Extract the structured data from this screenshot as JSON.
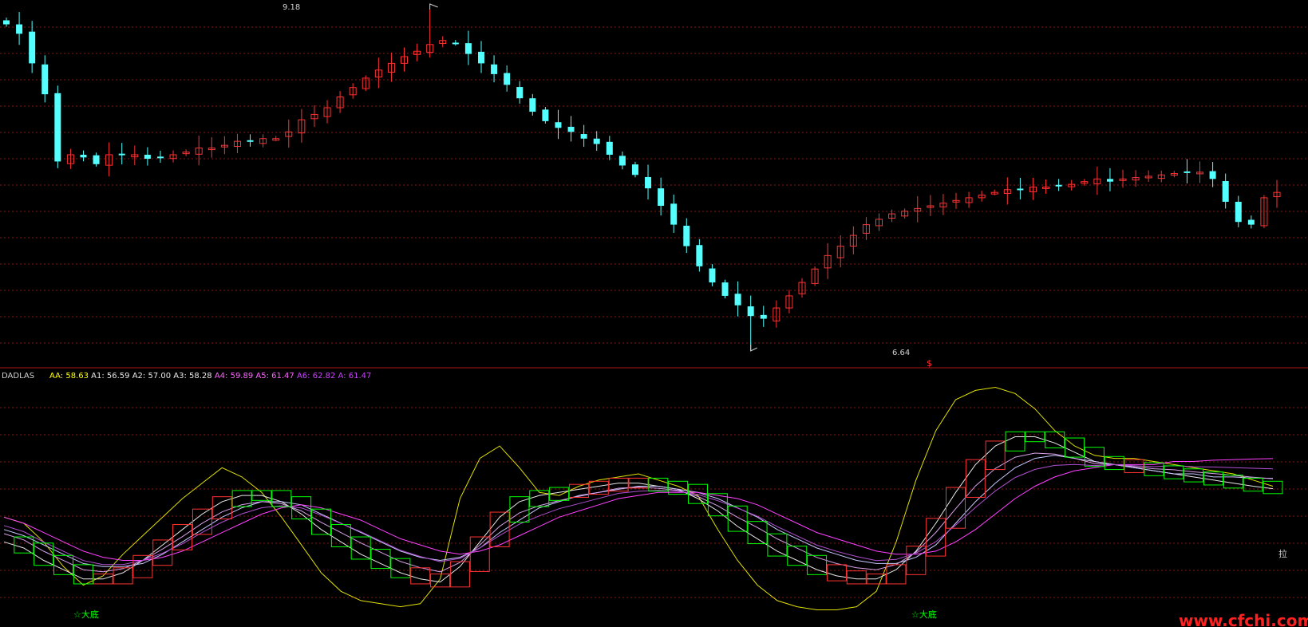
{
  "colors": {
    "background": "#000000",
    "grid": "#8a1414",
    "divider": "#b01818",
    "up": "#ff3232",
    "down": "#54ffff",
    "yellow": "#e0e000",
    "white": "#e8e8e8",
    "violet": "#ff40ff",
    "green": "#00ff00",
    "watermark": "#ff2020"
  },
  "price_panel": {
    "high_label": "9.18",
    "low_label": "6.64",
    "marker": "$"
  },
  "indicator_panel": {
    "name": "DADLAS",
    "values": [
      {
        "key": "AA",
        "value": "58.63",
        "color": "#ffff00"
      },
      {
        "key": "A1",
        "value": "56.59",
        "color": "#e8e8e8"
      },
      {
        "key": "A2",
        "value": "57.00",
        "color": "#e8e8e8"
      },
      {
        "key": "A3",
        "value": "58.28",
        "color": "#e8e8e8"
      },
      {
        "key": "A4",
        "value": "59.89",
        "color": "#ff66ff"
      },
      {
        "key": "A5",
        "value": "61.47",
        "color": "#ff66ff"
      },
      {
        "key": "A6",
        "value": "62.82",
        "color": "#cc44ff"
      },
      {
        "key": "A",
        "value": "61.47",
        "color": "#cc44ff"
      }
    ],
    "signal_labels": [
      "☆大底",
      "☆大底"
    ],
    "side_label": "拉"
  },
  "watermark": "www.cfchi.com",
  "chart_data": [
    {
      "type": "candlestick",
      "annotations": [
        "9.18",
        "6.64"
      ],
      "closes": [
        9.07,
        9.0,
        8.78,
        8.55,
        8.05,
        8.1,
        8.08,
        8.03,
        8.1,
        8.1,
        8.1,
        8.07,
        8.08,
        8.1,
        8.12,
        8.15,
        8.15,
        8.17,
        8.2,
        8.2,
        8.22,
        8.22,
        8.27,
        8.36,
        8.4,
        8.45,
        8.53,
        8.6,
        8.67,
        8.73,
        8.78,
        8.83,
        8.87,
        8.92,
        8.95,
        8.93,
        8.85,
        8.78,
        8.7,
        8.62,
        8.52,
        8.42,
        8.35,
        8.3,
        8.27,
        8.22,
        8.18,
        8.1,
        8.02,
        7.95,
        7.85,
        7.72,
        7.58,
        7.42,
        7.27,
        7.15,
        7.05,
        6.98,
        6.9,
        6.88,
        6.96,
        7.05,
        7.15,
        7.25,
        7.35,
        7.42,
        7.5,
        7.58,
        7.62,
        7.66,
        7.68,
        7.7,
        7.72,
        7.74,
        7.76,
        7.78,
        7.8,
        7.82,
        7.84,
        7.84,
        7.86,
        7.86,
        7.87,
        7.88,
        7.9,
        7.92,
        7.9,
        7.92,
        7.93,
        7.94,
        7.95,
        7.96,
        7.97,
        7.97,
        7.92,
        7.75,
        7.6,
        7.58,
        7.78,
        7.82
      ],
      "high": 9.18,
      "low": 6.64
    },
    {
      "type": "line",
      "series": [
        {
          "name": "AA",
          "values": [
            52.0,
            51.0,
            48.0,
            44.0,
            41.0,
            42.5,
            46.0,
            49.0,
            52.0,
            55.0,
            57.5,
            60.0,
            58.5,
            56.0,
            52.0,
            47.5,
            43.0,
            40.0,
            38.5,
            38.0,
            37.5,
            38.0,
            42.0,
            55.0,
            61.5,
            63.5,
            60.0,
            56.0,
            55.5,
            57.0,
            58.0,
            58.5,
            59.0,
            58.0,
            57.0,
            55.5,
            50.0,
            45.0,
            41.0,
            38.5,
            37.5,
            37.0,
            37.0,
            37.5,
            40.0,
            48.0,
            58.0,
            66.0,
            71.0,
            72.5,
            73.0,
            72.0,
            69.5,
            66.0,
            63.5,
            62.0,
            61.5,
            61.5,
            61.0,
            60.5,
            60.0,
            59.5,
            59.0,
            58.0,
            57.0
          ]
        },
        {
          "name": "A1",
          "values": [
            48.0,
            47.0,
            45.0,
            43.5,
            42.0,
            42.0,
            43.0,
            45.0,
            47.5,
            50.0,
            52.5,
            54.5,
            55.5,
            55.5,
            54.5,
            52.5,
            50.0,
            48.0,
            46.0,
            44.5,
            43.0,
            42.0,
            41.5,
            44.0,
            48.0,
            52.0,
            54.5,
            55.5,
            56.0,
            56.5,
            57.0,
            57.5,
            57.5,
            57.0,
            56.5,
            55.0,
            53.0,
            50.5,
            48.5,
            46.5,
            45.0,
            43.5,
            42.5,
            42.0,
            42.0,
            43.5,
            46.5,
            51.0,
            56.0,
            60.5,
            63.5,
            65.0,
            65.0,
            64.0,
            62.5,
            61.0,
            60.5,
            60.0,
            59.5,
            59.0,
            58.5,
            58.0,
            57.5,
            57.0,
            56.6
          ]
        },
        {
          "name": "A3",
          "values": [
            50.0,
            49.0,
            47.5,
            46.0,
            44.5,
            44.0,
            44.0,
            44.5,
            46.0,
            48.0,
            50.0,
            52.0,
            53.5,
            54.5,
            54.5,
            54.0,
            52.5,
            51.0,
            49.5,
            48.0,
            46.5,
            45.5,
            45.0,
            45.5,
            47.0,
            49.5,
            51.5,
            53.5,
            54.5,
            55.5,
            56.0,
            56.5,
            57.0,
            57.0,
            56.5,
            56.0,
            55.0,
            53.5,
            52.0,
            50.0,
            48.5,
            47.0,
            46.0,
            45.0,
            44.5,
            44.5,
            45.5,
            47.5,
            51.0,
            54.5,
            57.5,
            60.0,
            61.5,
            62.0,
            61.5,
            61.0,
            60.5,
            60.0,
            59.5,
            59.0,
            59.0,
            58.5,
            58.5,
            58.3,
            58.28
          ]
        },
        {
          "name": "A5",
          "values": [
            52.0,
            51.0,
            49.5,
            48.0,
            46.5,
            45.5,
            45.0,
            45.0,
            45.5,
            46.5,
            48.0,
            49.5,
            51.0,
            52.5,
            53.5,
            54.0,
            53.5,
            52.5,
            51.5,
            50.0,
            48.5,
            47.5,
            46.5,
            46.0,
            46.5,
            47.5,
            49.0,
            50.5,
            52.0,
            53.0,
            54.0,
            55.0,
            55.5,
            56.0,
            56.0,
            56.0,
            55.5,
            55.0,
            54.0,
            52.5,
            51.0,
            49.5,
            48.5,
            47.5,
            46.5,
            46.0,
            46.0,
            46.5,
            48.0,
            50.0,
            52.5,
            55.0,
            57.0,
            58.5,
            59.5,
            60.0,
            60.5,
            60.5,
            60.5,
            61.0,
            61.0,
            61.2,
            61.3,
            61.4,
            61.47
          ]
        }
      ]
    }
  ]
}
